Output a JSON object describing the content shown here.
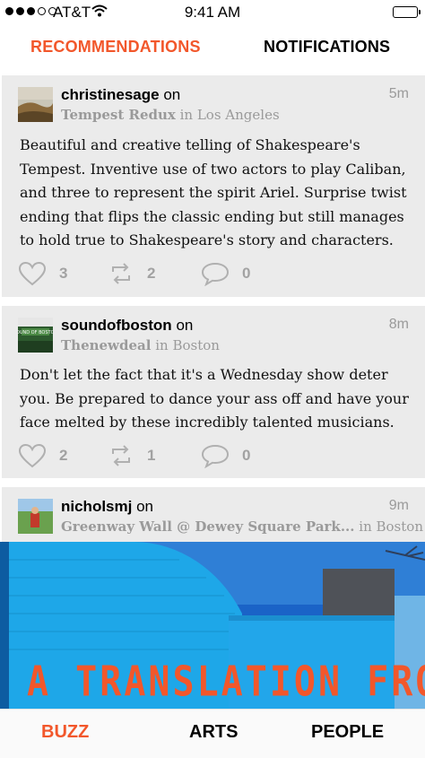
{
  "status_bar": {
    "carrier": "AT&T",
    "time": "9:41 AM",
    "signal_bars": 3,
    "signal_total": 5
  },
  "top_tabs": {
    "recommendations": "RECOMMENDATIONS",
    "notifications": "NOTIFICATIONS"
  },
  "posts": [
    {
      "username": "christinesage",
      "on": "on",
      "venue": "Tempest Redux",
      "location": "in Los Angeles",
      "time_ago": "5m",
      "body": "Beautiful and creative telling of Shakespeare's Tempest. Inventive use of two actors to play Caliban, and three to represent the spirit Ariel. Surprise twist ending that flips the classic ending but still manages to hold true to Shakespeare's story and characters.",
      "likes": "3",
      "reposts": "2",
      "comments": "0"
    },
    {
      "username": "soundofboston",
      "on": "on",
      "venue": "Thenewdeal",
      "location": "in Boston",
      "time_ago": "8m",
      "body": "Don't let the fact that it's a Wednesday show deter you. Be prepared to dance your ass off and have your face melted by these incredibly talented musicians.",
      "likes": "2",
      "reposts": "1",
      "comments": "0"
    },
    {
      "username": "nicholsmj",
      "on": "on",
      "venue": "Greenway Wall @ Dewey Square Park...",
      "location": "in Boston",
      "time_ago": "9m",
      "photo_text": "A TRANSLATION FROM"
    }
  ],
  "bottom_nav": {
    "buzz": "BUZZ",
    "arts": "ARTS",
    "people": "PEOPLE"
  },
  "colors": {
    "accent": "#f2572b",
    "card_bg": "#ebebeb",
    "muted": "#9a9a9a",
    "sky": "#1a63c7",
    "building_blue": "#1ea7e8"
  },
  "icons": [
    "wifi-icon",
    "battery-icon",
    "heart-icon",
    "repost-icon",
    "comment-icon"
  ]
}
